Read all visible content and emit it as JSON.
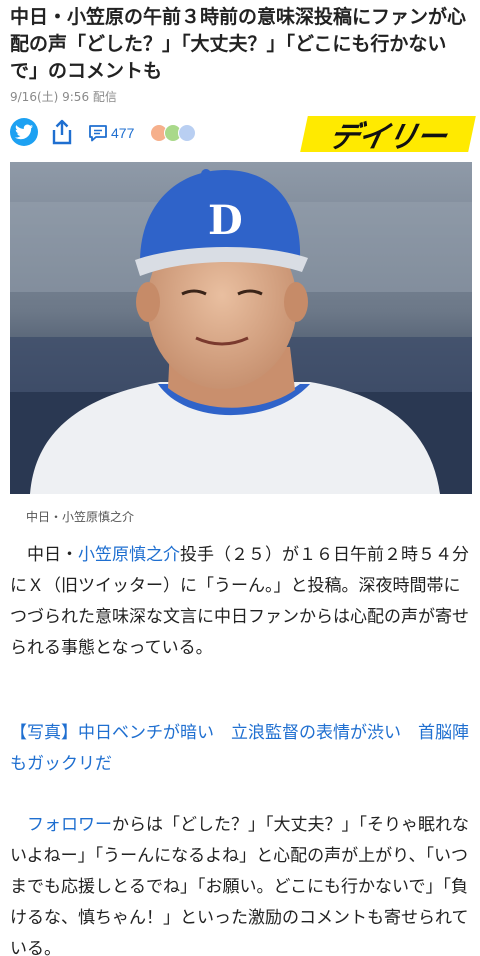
{
  "article": {
    "headline": "中日・小笠原の午前３時前の意味深投稿にファンが心配の声「どした？」「大丈夫？」「どこにも行かないで」のコメントも",
    "date": "9/16(土) 9:56 配信",
    "comment_count": "477",
    "publisher_logo": "デイリー",
    "photo_caption": "中日・小笠原慎之介",
    "p1_pre": "中日・",
    "p1_link": "小笠原慎之介",
    "p1_post": "投手（２５）が１６日午前２時５４分にＸ（旧ツイッター）に「うーん。」と投稿。深夜時間帯につづられた意味深な文言に中日ファンからは心配の声が寄せられる事態となっている。",
    "photo_link": "【写真】中日ベンチが暗い　立浪監督の表情が渋い　首脳陣もガックリだ",
    "p2_link": "フォロワー",
    "p2_post": "からは「どした？」「大丈夫？」「そりゃ眠れないよねー」「うーんになるよね」と心配の声が上がり、「いつまでも応援しとるでね」「お願い。どこにも行かないで」「負けるな、慎ちゃん！」といった激励のコメントも寄せられている。"
  },
  "icons": {
    "twitter": "twitter-bird-icon",
    "share": "share-icon",
    "comment": "comment-bubble-icon",
    "reactions": [
      "face-icon-orange",
      "face-icon-green",
      "face-icon-blue"
    ]
  },
  "colors": {
    "link": "#1f6fd0",
    "twitter": "#1da1f2",
    "logo_bg": "#ffea00",
    "cap": "#2f63c9"
  }
}
